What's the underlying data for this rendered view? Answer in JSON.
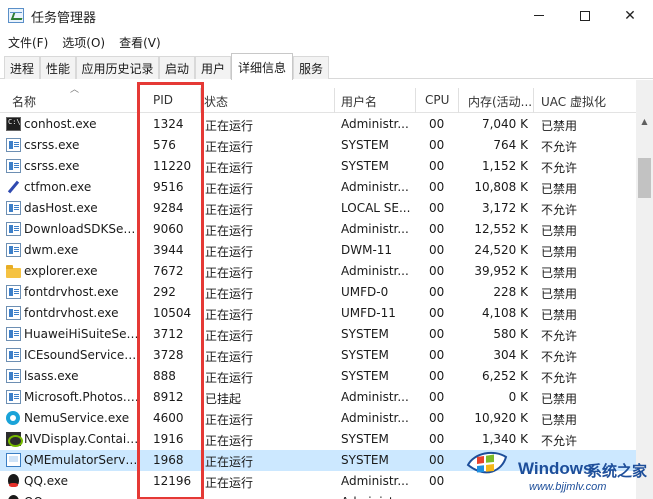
{
  "window": {
    "title": "任务管理器"
  },
  "menu": [
    {
      "label": "文件(F)"
    },
    {
      "label": "选项(O)"
    },
    {
      "label": "查看(V)"
    }
  ],
  "tabs": [
    {
      "label": "进程"
    },
    {
      "label": "性能"
    },
    {
      "label": "应用历史记录"
    },
    {
      "label": "启动"
    },
    {
      "label": "用户"
    },
    {
      "label": "详细信息",
      "active": true
    },
    {
      "label": "服务"
    }
  ],
  "columns": {
    "name": "名称",
    "pid": "PID",
    "status": "状态",
    "user": "用户名",
    "cpu": "CPU",
    "mem": "内存(活动...",
    "uac": "UAC 虚拟化"
  },
  "rows": [
    {
      "icon": "console-icon",
      "name": "conhost.exe",
      "pid": "1324",
      "status": "正在运行",
      "user": "Administr...",
      "cpu": "00",
      "mem": "7,040 K",
      "uac": "已禁用"
    },
    {
      "icon": "process-icon",
      "name": "csrss.exe",
      "pid": "576",
      "status": "正在运行",
      "user": "SYSTEM",
      "cpu": "00",
      "mem": "764 K",
      "uac": "不允许"
    },
    {
      "icon": "process-icon",
      "name": "csrss.exe",
      "pid": "11220",
      "status": "正在运行",
      "user": "SYSTEM",
      "cpu": "00",
      "mem": "1,152 K",
      "uac": "不允许"
    },
    {
      "icon": "pen-icon",
      "name": "ctfmon.exe",
      "pid": "9516",
      "status": "正在运行",
      "user": "Administr...",
      "cpu": "00",
      "mem": "10,808 K",
      "uac": "已禁用"
    },
    {
      "icon": "process-icon",
      "name": "dasHost.exe",
      "pid": "9284",
      "status": "正在运行",
      "user": "LOCAL SE...",
      "cpu": "00",
      "mem": "3,172 K",
      "uac": "不允许"
    },
    {
      "icon": "process-icon",
      "name": "DownloadSDKServ...",
      "pid": "9060",
      "status": "正在运行",
      "user": "Administr...",
      "cpu": "00",
      "mem": "12,552 K",
      "uac": "已禁用"
    },
    {
      "icon": "process-icon",
      "name": "dwm.exe",
      "pid": "3944",
      "status": "正在运行",
      "user": "DWM-11",
      "cpu": "00",
      "mem": "24,520 K",
      "uac": "已禁用"
    },
    {
      "icon": "folder-icon",
      "name": "explorer.exe",
      "pid": "7672",
      "status": "正在运行",
      "user": "Administr...",
      "cpu": "00",
      "mem": "39,952 K",
      "uac": "已禁用"
    },
    {
      "icon": "process-icon",
      "name": "fontdrvhost.exe",
      "pid": "292",
      "status": "正在运行",
      "user": "UMFD-0",
      "cpu": "00",
      "mem": "228 K",
      "uac": "已禁用"
    },
    {
      "icon": "process-icon",
      "name": "fontdrvhost.exe",
      "pid": "10504",
      "status": "正在运行",
      "user": "UMFD-11",
      "cpu": "00",
      "mem": "4,108 K",
      "uac": "已禁用"
    },
    {
      "icon": "process-icon",
      "name": "HuaweiHiSuiteServi...",
      "pid": "3712",
      "status": "正在运行",
      "user": "SYSTEM",
      "cpu": "00",
      "mem": "580 K",
      "uac": "不允许"
    },
    {
      "icon": "process-icon",
      "name": "ICEsoundService64...",
      "pid": "3728",
      "status": "正在运行",
      "user": "SYSTEM",
      "cpu": "00",
      "mem": "304 K",
      "uac": "不允许"
    },
    {
      "icon": "process-icon",
      "name": "lsass.exe",
      "pid": "888",
      "status": "正在运行",
      "user": "SYSTEM",
      "cpu": "00",
      "mem": "6,252 K",
      "uac": "不允许"
    },
    {
      "icon": "process-icon",
      "name": "Microsoft.Photos.e...",
      "pid": "8912",
      "status": "已挂起",
      "user": "Administr...",
      "cpu": "00",
      "mem": "0 K",
      "uac": "已禁用"
    },
    {
      "icon": "nemu-icon",
      "name": "NemuService.exe",
      "pid": "4600",
      "status": "正在运行",
      "user": "Administr...",
      "cpu": "00",
      "mem": "10,920 K",
      "uac": "已禁用"
    },
    {
      "icon": "nvidia-icon",
      "name": "NVDisplay.Contain...",
      "pid": "1916",
      "status": "正在运行",
      "user": "SYSTEM",
      "cpu": "00",
      "mem": "1,340 K",
      "uac": "不允许"
    },
    {
      "icon": "emulator-icon",
      "name": "QMEmulatorServic...",
      "pid": "1968",
      "status": "正在运行",
      "user": "SYSTEM",
      "cpu": "00",
      "mem": "",
      "uac": "",
      "selected": true
    },
    {
      "icon": "qq-icon",
      "name": "QQ.exe",
      "pid": "12196",
      "status": "正在运行",
      "user": "Administr...",
      "cpu": "00",
      "mem": "",
      "uac": ""
    },
    {
      "icon": "qq-icon",
      "name": "QQ...",
      "pid": "",
      "status": "",
      "user": "Administr...",
      "cpu": "",
      "mem": "",
      "uac": ""
    }
  ],
  "watermark": {
    "brand": "Windows",
    "cn": "系统之家",
    "url": "www.bjjmlv.com"
  },
  "colors": {
    "highlight": "#e53935",
    "selection": "#cce8ff"
  }
}
